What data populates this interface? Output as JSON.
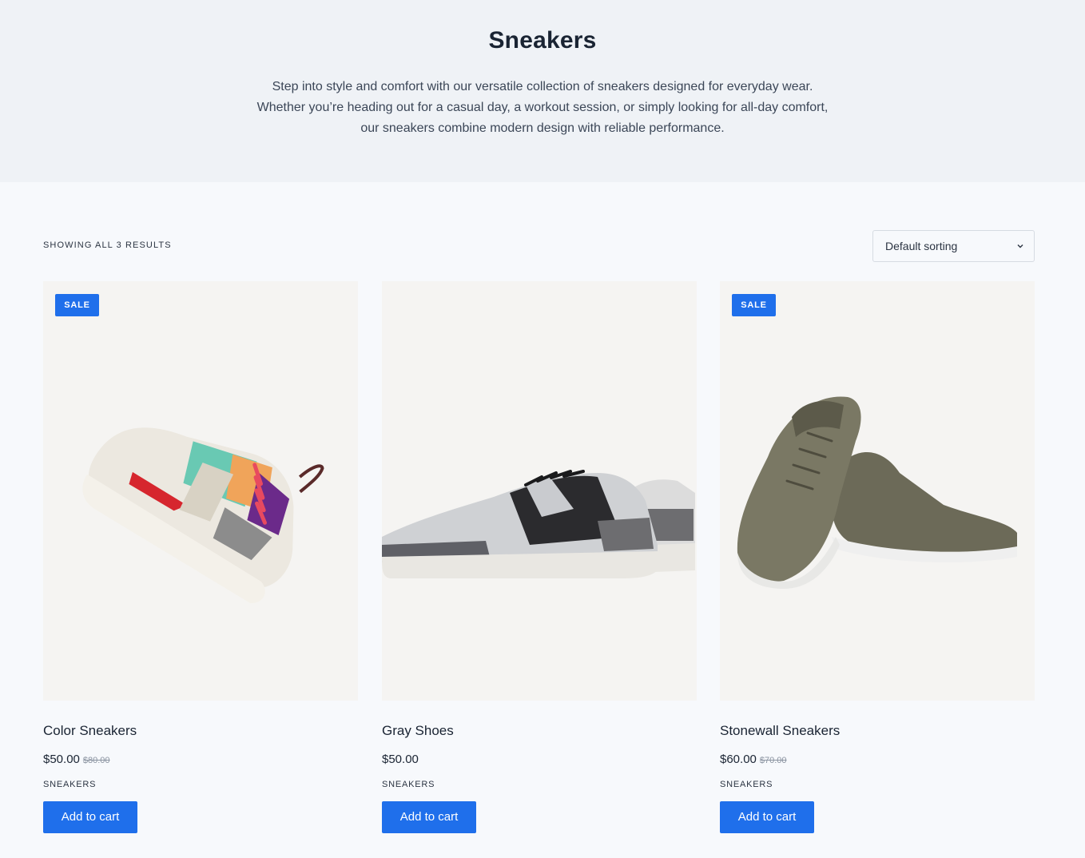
{
  "hero": {
    "title": "Sneakers",
    "description_lines": [
      "Step into style and comfort with our versatile collection of sneakers designed for everyday wear.",
      "Whether you’re heading out for a casual day, a workout session, or simply looking for all-day comfort,",
      "our sneakers combine modern design with reliable performance."
    ]
  },
  "toolbar": {
    "results_count": "SHOWING ALL 3 RESULTS",
    "sort_selected": "Default sorting",
    "sort_icon": "chevron-down-icon"
  },
  "colors": {
    "accent": "#1f6feb",
    "hero_bg": "#eff2f6",
    "page_bg": "#f7f9fc",
    "image_bg": "#f5f4f2"
  },
  "products": [
    {
      "title": "Color Sneakers",
      "price": "$50.00",
      "old_price": "$80.00",
      "badge": "SALE",
      "category": "SNEAKERS",
      "button": "Add to cart",
      "image": "multicolor-sneaker-image"
    },
    {
      "title": "Gray Shoes",
      "price": "$50.00",
      "old_price": "",
      "badge": "",
      "category": "SNEAKERS",
      "button": "Add to cart",
      "image": "gray-shoes-image"
    },
    {
      "title": "Stonewall Sneakers",
      "price": "$60.00",
      "old_price": "$70.00",
      "badge": "SALE",
      "category": "SNEAKERS",
      "button": "Add to cart",
      "image": "olive-sneakers-image"
    }
  ]
}
